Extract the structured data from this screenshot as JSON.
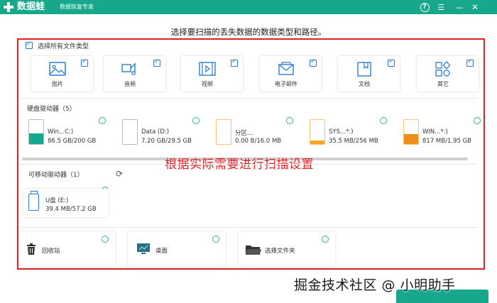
{
  "titlebar": {
    "app_name": "数据蛙",
    "subtitle": "数据恢复专家",
    "help": "?",
    "menu": "☰",
    "minimize": "—",
    "close": "✕"
  },
  "instruction": "选择要扫描的丢失数据的数据类型和路径。",
  "select_all_label": "选择所有文件类型",
  "file_types": [
    {
      "label": "图片",
      "icon": "image-icon"
    },
    {
      "label": "音频",
      "icon": "music-icon"
    },
    {
      "label": "视频",
      "icon": "video-icon"
    },
    {
      "label": "电子邮件",
      "icon": "email-icon"
    },
    {
      "label": "文档",
      "icon": "document-icon"
    },
    {
      "label": "其它",
      "icon": "other-icon"
    }
  ],
  "hard_drives": {
    "title": "硬盘驱动器（5）",
    "drives": [
      {
        "name": "Win...C:)",
        "size": "86.5 GB/200 GB",
        "fill": 0.43,
        "color": "#17a88c"
      },
      {
        "name": "Data (D:)",
        "size": "7.20 GB/29.5 GB",
        "fill": 0.0,
        "color": "#17a88c"
      },
      {
        "name": "分区...",
        "size": "0.00  B/16.0 MB",
        "fill": 0.0,
        "color": "#f5a623"
      },
      {
        "name": "SYS...*:)",
        "size": "35.5 MB/256 MB",
        "fill": 0.14,
        "color": "#f5a623"
      },
      {
        "name": "WIN...*:)",
        "size": "817 MB/1.95 GB",
        "fill": 0.42,
        "color": "#f0901a"
      }
    ]
  },
  "overlay_text": "根据实际需要进行扫描设置",
  "removable": {
    "title": "可移动驱动器（1）",
    "refresh": "⟳",
    "drive": {
      "name": "U盘 (E:)",
      "size": "39.4 MB/57.2 GB"
    }
  },
  "locations": [
    {
      "label": "回收站",
      "icon": "recycle-bin-icon"
    },
    {
      "label": "桌面",
      "icon": "desktop-icon"
    },
    {
      "label": "选择文件夹",
      "icon": "folder-icon"
    }
  ],
  "watermark": "掘金技术社区 @ 小明助手",
  "colors": {
    "accent": "#17a88c",
    "annotation": "#e02020",
    "checkbox": "#2a7fd0"
  }
}
